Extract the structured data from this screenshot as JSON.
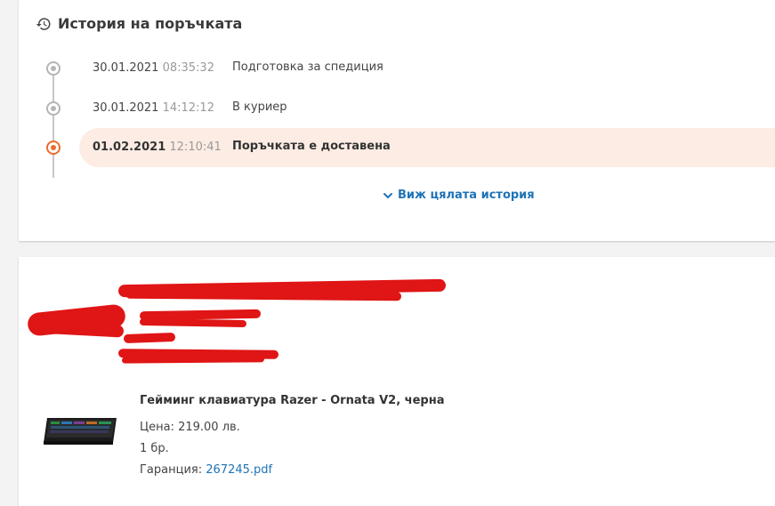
{
  "history": {
    "title": "История на поръчката",
    "icon": "history-icon",
    "entries": [
      {
        "date": "30.01.2021",
        "time": "08:35:32",
        "status": "Подготовка за спедиция",
        "active": false
      },
      {
        "date": "30.01.2021",
        "time": "14:12:12",
        "status": "В куриер",
        "active": false
      },
      {
        "date": "01.02.2021",
        "time": "12:10:41",
        "status": "Поръчката е доставена",
        "active": true
      }
    ],
    "view_all_label": "Виж цялата история"
  },
  "product": {
    "title": "Гейминг клавиатура Razer - Ornata V2, черна",
    "price_label": "Цена:",
    "price_value": "219.00 лв.",
    "quantity": "1 бр.",
    "warranty_label": "Гаранция:",
    "warranty_file": "267245.pdf"
  },
  "colors": {
    "accent": "#ef6a2e",
    "link": "#1f73b7",
    "active_bg": "#fdece4",
    "redaction": "#e01515"
  }
}
